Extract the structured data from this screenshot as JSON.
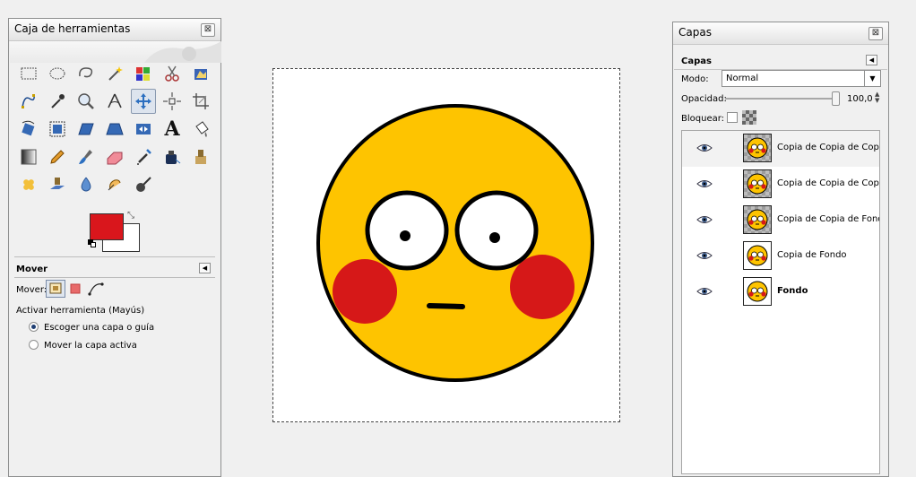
{
  "toolbox": {
    "title": "Caja de herramientas",
    "close_label": "⊠",
    "tools": [
      {
        "name": "rect-select",
        "active": false
      },
      {
        "name": "ellipse-select",
        "active": false
      },
      {
        "name": "free-select",
        "active": false
      },
      {
        "name": "fuzzy-select",
        "active": false
      },
      {
        "name": "color-select",
        "active": false
      },
      {
        "name": "scissors-select",
        "active": false
      },
      {
        "name": "foreground-select",
        "active": false
      },
      {
        "name": "paths",
        "active": false
      },
      {
        "name": "color-picker",
        "active": false
      },
      {
        "name": "zoom",
        "active": false
      },
      {
        "name": "measure",
        "active": false
      },
      {
        "name": "move",
        "active": true
      },
      {
        "name": "align",
        "active": false
      },
      {
        "name": "crop",
        "active": false
      },
      {
        "name": "rotate",
        "active": false
      },
      {
        "name": "scale",
        "active": false
      },
      {
        "name": "shear",
        "active": false
      },
      {
        "name": "perspective",
        "active": false
      },
      {
        "name": "flip",
        "active": false
      },
      {
        "name": "text",
        "active": false
      },
      {
        "name": "bucket-fill",
        "active": false
      },
      {
        "name": "blend",
        "active": false
      },
      {
        "name": "pencil",
        "active": false
      },
      {
        "name": "paintbrush",
        "active": false
      },
      {
        "name": "eraser",
        "active": false
      },
      {
        "name": "airbrush",
        "active": false
      },
      {
        "name": "ink",
        "active": false
      },
      {
        "name": "clone",
        "active": false
      },
      {
        "name": "heal",
        "active": false
      },
      {
        "name": "perspective-clone",
        "active": false
      },
      {
        "name": "blur",
        "active": false
      },
      {
        "name": "smudge",
        "active": false
      },
      {
        "name": "dodge-burn",
        "active": false
      }
    ],
    "text_glyph": "A",
    "colors": {
      "foreground": "#d9161c",
      "background": "#ffffff"
    }
  },
  "tool_options": {
    "title": "Mover",
    "move_label": "Mover:",
    "activate_label": "Activar herramienta  (Mayús)",
    "options": [
      {
        "label": "Escoger una capa o guía",
        "selected": true
      },
      {
        "label": "Mover la capa activa",
        "selected": false
      }
    ]
  },
  "layers_panel": {
    "title": "Capas",
    "close_label": "⊠",
    "tab_label": "Capas",
    "mode_label": "Modo:",
    "mode_value": "Normal",
    "opacity_label": "Opacidad:",
    "opacity_value": "100,0",
    "lock_label": "Bloquear:",
    "layers": [
      {
        "name": "Copia de Copia de Copia de Fondo",
        "bold": false,
        "checker": true,
        "selected": true
      },
      {
        "name": "Copia de Copia de Copia de Fondo",
        "bold": false,
        "checker": true,
        "selected": false
      },
      {
        "name": "Copia de Copia de Fondo",
        "bold": false,
        "checker": true,
        "selected": false
      },
      {
        "name": "Copia de Fondo",
        "bold": false,
        "checker": false,
        "selected": false
      },
      {
        "name": "Fondo",
        "bold": true,
        "checker": false,
        "selected": false
      }
    ]
  },
  "canvas": {
    "face_color": "#fec400",
    "cheek_color": "#d61818"
  }
}
